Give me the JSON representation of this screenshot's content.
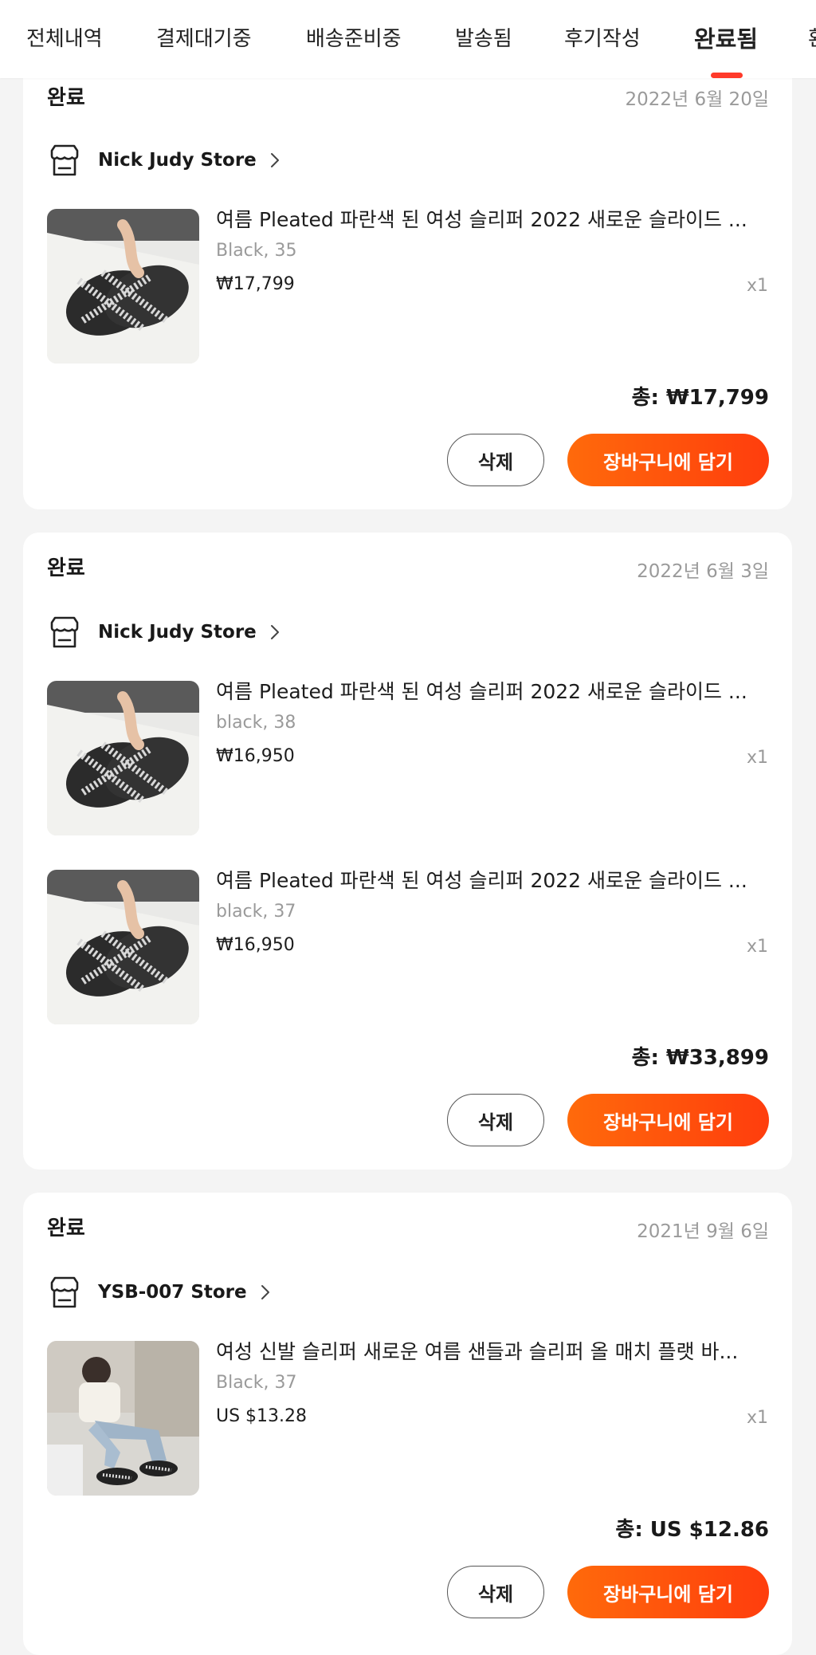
{
  "tabs": [
    {
      "label": "전체내역",
      "active": false
    },
    {
      "label": "결제대기중",
      "active": false
    },
    {
      "label": "배송준비중",
      "active": false
    },
    {
      "label": "발송됨",
      "active": false
    },
    {
      "label": "후기작성",
      "active": false
    },
    {
      "label": "완료됨",
      "active": true
    },
    {
      "label": "환",
      "active": false
    }
  ],
  "colors": {
    "accent": "#ff3a2a",
    "cart_button_start": "#ff6a0b",
    "cart_button_end": "#ff3d0d",
    "muted_text": "#9a9a9a",
    "background": "#f4f4f4"
  },
  "orders": [
    {
      "status": "완료",
      "date": "2022년 6월 20일",
      "store": {
        "name": "Nick Judy Store",
        "icon": "store-icon"
      },
      "items": [
        {
          "title": "여름 Pleated 파란색 된 여성 슬리퍼 2022 새로운 슬라이드 ...",
          "variant": "Black, 35",
          "price": "₩17,799",
          "qty": "x1",
          "image": "sandal-product-photo"
        }
      ],
      "total": "총: ₩17,799",
      "delete_label": "삭제",
      "cart_label": "장바구니에 담기"
    },
    {
      "status": "완료",
      "date": "2022년 6월 3일",
      "store": {
        "name": "Nick Judy Store",
        "icon": "store-icon"
      },
      "items": [
        {
          "title": "여름 Pleated 파란색 된 여성 슬리퍼 2022 새로운 슬라이드 ...",
          "variant": "black, 38",
          "price": "₩16,950",
          "qty": "x1",
          "image": "sandal-product-photo"
        },
        {
          "title": "여름 Pleated 파란색 된 여성 슬리퍼 2022 새로운 슬라이드 ...",
          "variant": "black, 37",
          "price": "₩16,950",
          "qty": "x1",
          "image": "sandal-product-photo"
        }
      ],
      "total": "총: ₩33,899",
      "delete_label": "삭제",
      "cart_label": "장바구니에 담기"
    },
    {
      "status": "완료",
      "date": "2021년 9월 6일",
      "store": {
        "name": "YSB-007 Store",
        "icon": "store-icon"
      },
      "items": [
        {
          "title": "여성 신발 슬리퍼 새로운 여름 샌들과 슬리퍼 올 매치 플랫 바...",
          "variant": "Black, 37",
          "price": "US $13.28",
          "qty": "x1",
          "image": "model-wearing-sandals-photo"
        }
      ],
      "total": "총: US $12.86",
      "delete_label": "삭제",
      "cart_label": "장바구니에 담기"
    }
  ]
}
